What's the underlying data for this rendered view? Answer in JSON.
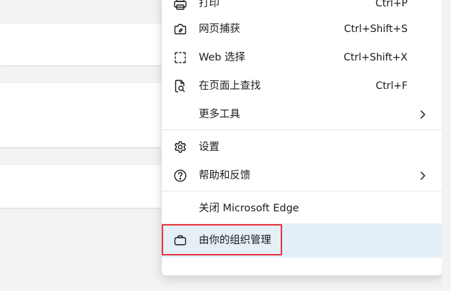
{
  "menu": {
    "items": [
      {
        "label": "打印",
        "shortcut": "Ctrl+P",
        "icon": "print-icon"
      },
      {
        "label": "网页捕获",
        "shortcut": "Ctrl+Shift+S",
        "icon": "web-capture-icon"
      },
      {
        "label": "Web 选择",
        "shortcut": "Ctrl+Shift+X",
        "icon": "web-select-icon"
      },
      {
        "label": "在页面上查找",
        "shortcut": "Ctrl+F",
        "icon": "find-on-page-icon"
      },
      {
        "label": "更多工具",
        "icon": "chevron-right-icon"
      },
      {
        "label": "设置",
        "icon": "gear-icon"
      },
      {
        "label": "帮助和反馈",
        "icon": "help-icon"
      },
      {
        "label": "关闭 Microsoft Edge"
      },
      {
        "label": "由你的组织管理",
        "icon": "briefcase-icon"
      }
    ]
  },
  "colors": {
    "accent_highlight": "#e8343d",
    "managed_background": "#e4eff8",
    "page_background": "#f3f3f3"
  }
}
